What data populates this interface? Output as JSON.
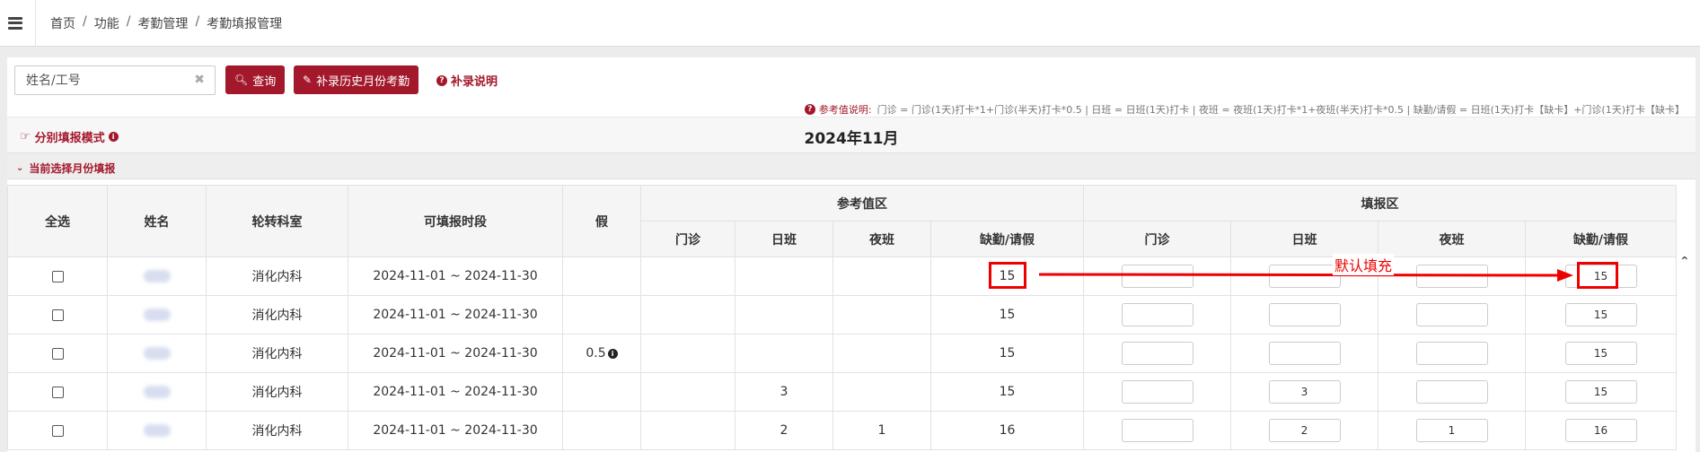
{
  "breadcrumb": [
    "首页",
    "功能",
    "考勤管理",
    "考勤填报管理"
  ],
  "search": {
    "placeholder": "姓名/工号",
    "clear": "✖"
  },
  "toolbar": {
    "query_label": "查询",
    "supplement_label": "补录历史月份考勤",
    "help_label": "补录说明"
  },
  "reference_note": {
    "label": "参考值说明:",
    "text": "门诊 = 门诊(1天)打卡*1+门诊(半天)打卡*0.5 | 日班 = 日班(1天)打卡 | 夜班 = 夜班(1天)打卡*1+夜班(半天)打卡*0.5 | 缺勤/请假 = 日班(1天)打卡【缺卡】+门诊(1天)打卡【缺卡】"
  },
  "mode": {
    "label": "分别填报模式"
  },
  "month_title": "2024年11月",
  "section": {
    "label": "当前选择月份填报"
  },
  "table": {
    "headers": {
      "select_all": "全选",
      "name": "姓名",
      "dept": "轮转科室",
      "period": "可填报时段",
      "leave": "假",
      "ref_group": "参考值区",
      "fill_group": "填报区"
    },
    "sub_headers": [
      "门诊",
      "日班",
      "夜班",
      "缺勤/请假"
    ],
    "rows": [
      {
        "dept": "消化内科",
        "period": "2024-11-01 ~ 2024-11-30",
        "leave": "",
        "ref_outpatient": "",
        "ref_day": "",
        "ref_night": "",
        "ref_absence": "15",
        "fill_outpatient": "",
        "fill_day": "",
        "fill_night": "",
        "fill_absence": "15"
      },
      {
        "dept": "消化内科",
        "period": "2024-11-01 ~ 2024-11-30",
        "leave": "",
        "ref_outpatient": "",
        "ref_day": "",
        "ref_night": "",
        "ref_absence": "15",
        "fill_outpatient": "",
        "fill_day": "",
        "fill_night": "",
        "fill_absence": "15"
      },
      {
        "dept": "消化内科",
        "period": "2024-11-01 ~ 2024-11-30",
        "leave": "0.5",
        "ref_outpatient": "",
        "ref_day": "",
        "ref_night": "",
        "ref_absence": "15",
        "fill_outpatient": "",
        "fill_day": "",
        "fill_night": "",
        "fill_absence": "15"
      },
      {
        "dept": "消化内科",
        "period": "2024-11-01 ~ 2024-11-30",
        "leave": "",
        "ref_outpatient": "",
        "ref_day": "3",
        "ref_night": "",
        "ref_absence": "15",
        "fill_outpatient": "",
        "fill_day": "3",
        "fill_night": "",
        "fill_absence": "15"
      },
      {
        "dept": "消化内科",
        "period": "2024-11-01 ~ 2024-11-30",
        "leave": "",
        "ref_outpatient": "",
        "ref_day": "2",
        "ref_night": "1",
        "ref_absence": "16",
        "fill_outpatient": "",
        "fill_day": "2",
        "fill_night": "1",
        "fill_absence": "16"
      }
    ]
  },
  "annotation": {
    "callout": "默认填充",
    "color": "#e00000"
  },
  "colors": {
    "accent": "#a3182b"
  }
}
